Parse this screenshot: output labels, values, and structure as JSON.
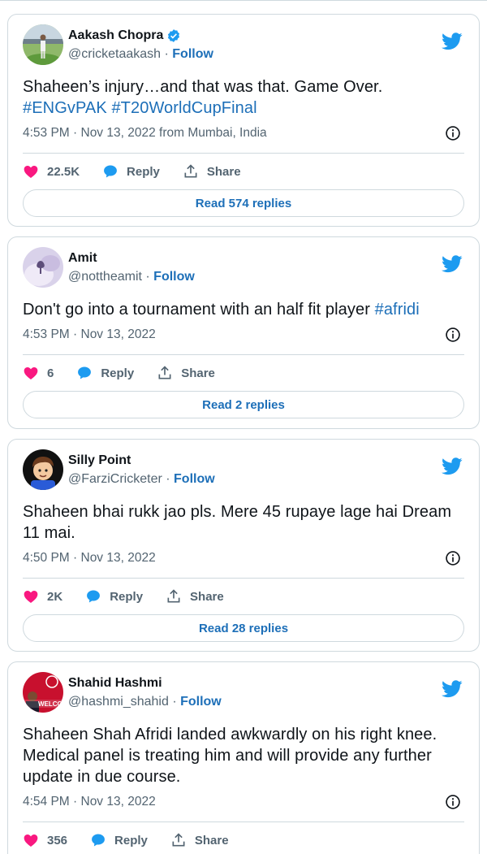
{
  "follow_label": "Follow",
  "tweets": [
    {
      "name": "Aakash Chopra",
      "verified": true,
      "handle": "@cricketaakash",
      "sep": " · ",
      "text": "Shaheen’s injury…and that was that. Game Over.",
      "hashtags": "#ENGvPAK #T20WorldCupFinal",
      "meta": "4:53 PM · Nov 13, 2022 from Mumbai, India",
      "likes": "22.5K",
      "reply_label": "Reply",
      "share_label": "Share",
      "read_label": "Read 574 replies"
    },
    {
      "name": "Amit",
      "verified": false,
      "handle": "@nottheamit",
      "sep": " · ",
      "text": "Don't go into a tournament with an half fit player ",
      "hashtags": "#afridi",
      "meta": "4:53 PM · Nov 13, 2022",
      "likes": "6",
      "reply_label": "Reply",
      "share_label": "Share",
      "read_label": "Read 2 replies"
    },
    {
      "name": "Silly Point",
      "verified": false,
      "handle": "@FarziCricketer",
      "sep": " · ",
      "text": "Shaheen bhai rukk jao pls. Mere 45 rupaye lage hai Dream 11 mai.",
      "hashtags": "",
      "meta": "4:50 PM · Nov 13, 2022",
      "likes": "2K",
      "reply_label": "Reply",
      "share_label": "Share",
      "read_label": "Read 28 replies"
    },
    {
      "name": "Shahid Hashmi",
      "verified": false,
      "handle": "@hashmi_shahid",
      "sep": " · ",
      "text": "Shaheen Shah Afridi landed awkwardly on his right knee. Medical panel is treating him and will provide any further update in due course.",
      "hashtags": "",
      "meta": "4:54 PM · Nov 13, 2022",
      "likes": "356",
      "reply_label": "Reply",
      "share_label": "Share",
      "avatar_sign_text": "WELCO"
    }
  ],
  "colors": {
    "link": "#1d6fb8",
    "twitter_blue": "#1d9bf0",
    "heart": "#f91880",
    "reply": "#1d9bf0",
    "border": "#cfd9de",
    "muted": "#536471"
  },
  "icons": [
    "verified-badge-icon",
    "twitter-bird-icon",
    "info-icon",
    "heart-icon",
    "reply-bubble-icon",
    "share-icon"
  ]
}
